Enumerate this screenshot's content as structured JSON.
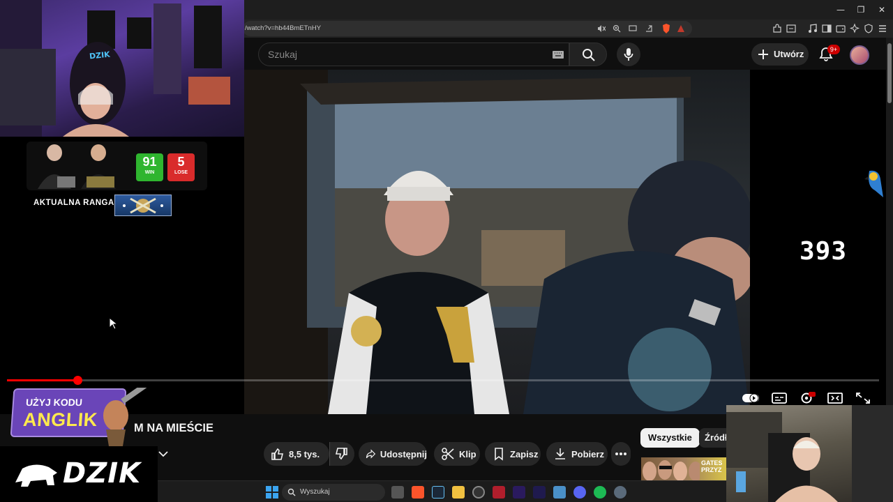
{
  "browser": {
    "url": "/watch?v=hb44BmETnHY",
    "window_controls": [
      "minimize-icon",
      "restore-icon",
      "close-icon"
    ]
  },
  "youtube": {
    "search_placeholder": "Szukaj",
    "create_label": "Utwórz",
    "notifications_badge": "9+",
    "video_title_visible": "M NA MIEŚCIE",
    "progress_fraction": 0.081,
    "actions": {
      "like_count": "8,5 tys.",
      "share": "Udostępnij",
      "clip": "Klip",
      "save": "Zapisz",
      "download": "Pobierz"
    },
    "chips": [
      "Wszystkie",
      "Źródło"
    ],
    "thumbnail_text": "GATES PRZYZ"
  },
  "overlay": {
    "counter": "393",
    "cam_logo": "DZIK",
    "score": {
      "win": "91",
      "win_label": "WIN",
      "lose": "5",
      "lose_label": "LOSE"
    },
    "rank_label": "AKTUALNA RANGA:",
    "promo_line1": "UŻYJ KODU",
    "promo_code": "ANGLIK",
    "brand": "DZIK"
  },
  "taskbar": {
    "search_placeholder": "Wyszukaj"
  },
  "colors": {
    "youtube_red": "#ff0000",
    "win_green": "#2fb52f",
    "lose_red": "#d92b2b",
    "promo_purple": "#6a45b8",
    "promo_yellow": "#ffe94d"
  }
}
